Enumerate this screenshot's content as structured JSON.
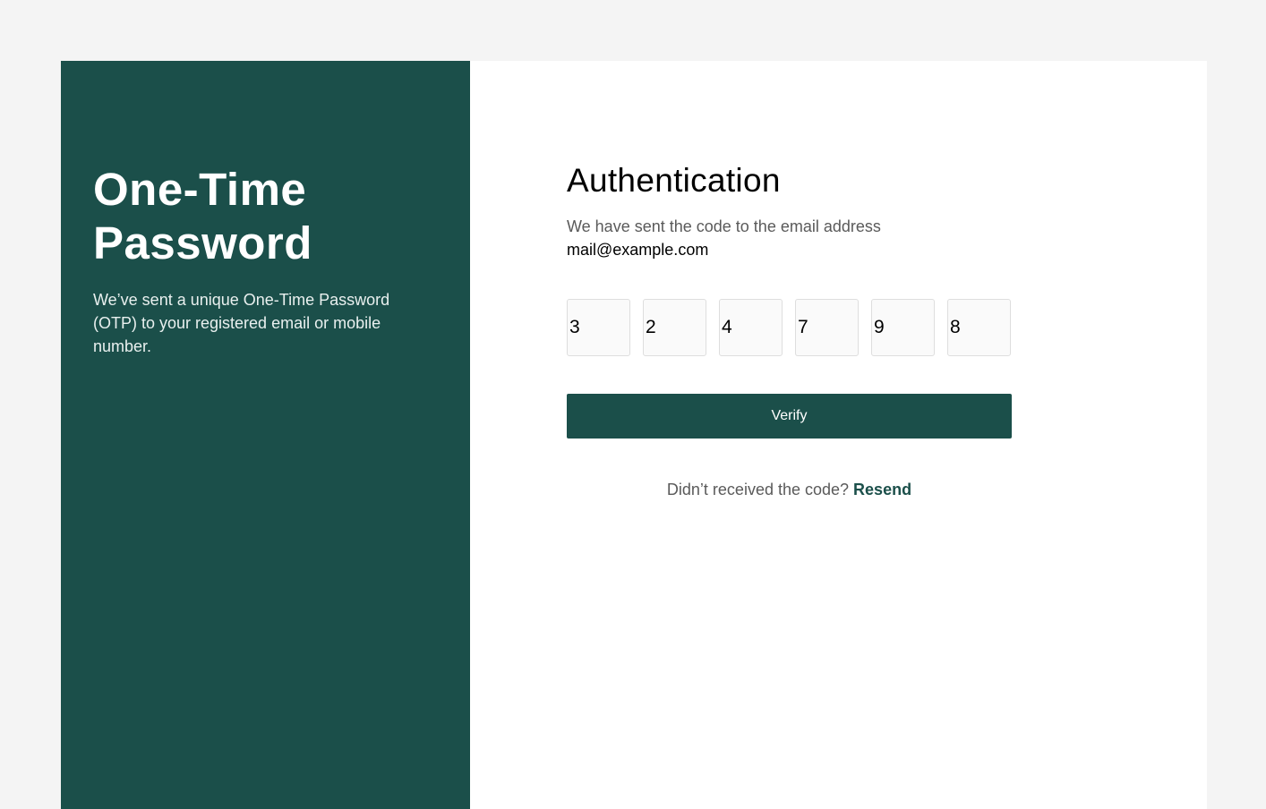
{
  "left": {
    "title_line1": "One-Time",
    "title_line2": "Password",
    "description": "We’ve sent a unique One-Time Password (OTP) to your registered email or mobile number."
  },
  "auth": {
    "title": "Authentication",
    "subtitle": "We have sent the code to the email address",
    "email": "mail@example.com",
    "otp_digits": [
      "3",
      "2",
      "4",
      "7",
      "9",
      "8"
    ],
    "verify_label": "Verify",
    "resend_prompt": "Didn’t received the code?",
    "resend_label": "Resend"
  },
  "colors": {
    "primary": "#1b4f4a",
    "background": "#f4f4f4",
    "card": "#ffffff",
    "muted_text": "#5a5a5a"
  }
}
